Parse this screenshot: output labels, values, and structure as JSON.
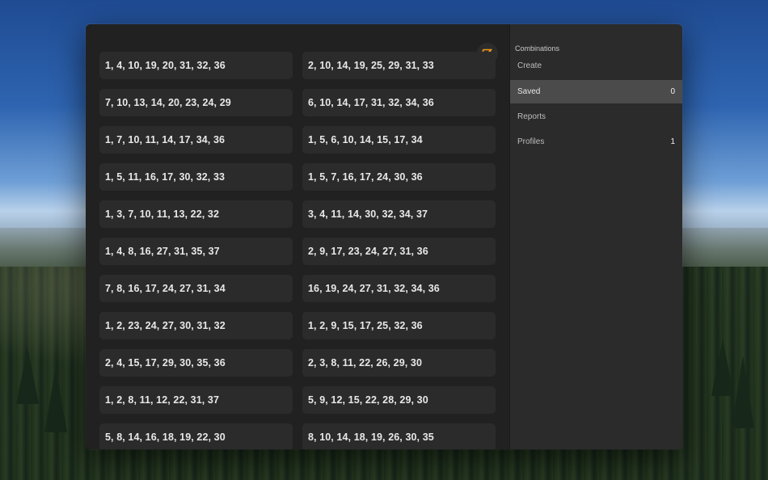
{
  "combinations": [
    "1, 4, 10, 19, 20, 31, 32, 36",
    "2, 10, 14, 19, 25, 29, 31, 33",
    "7, 10, 13, 14, 20, 23, 24, 29",
    "6, 10, 14, 17, 31, 32, 34, 36",
    "1, 7, 10, 11, 14, 17, 34, 36",
    "1, 5, 6, 10, 14, 15, 17, 34",
    "1, 5, 11, 16, 17, 30, 32, 33",
    "1, 5, 7, 16, 17, 24, 30, 36",
    "1, 3, 7, 10, 11, 13, 22, 32",
    "3, 4, 11, 14, 30, 32, 34, 37",
    "1, 4, 8, 16, 27, 31, 35, 37",
    "2, 9, 17, 23, 24, 27, 31, 36",
    "7, 8, 16, 17, 24, 27, 31, 34",
    "16, 19, 24, 27, 31, 32, 34, 36",
    "1, 2, 23, 24, 27, 30, 31, 32",
    "1, 2, 9, 15, 17, 25, 32, 36",
    "2, 4, 15, 17, 29, 30, 35, 36",
    "2, 3, 8, 11, 22, 26, 29, 30",
    "1, 2, 8, 11, 12, 22, 31, 37",
    "5, 9, 12, 15, 22, 28, 29, 30",
    "5, 8, 14, 16, 18, 19, 22, 30",
    "8, 10, 14, 18, 19, 26, 30, 35"
  ],
  "toolbar": {
    "compose_icon": "compose-icon",
    "accent_color": "#f39a1e"
  },
  "sidebar": {
    "header": "Combinations",
    "items": [
      {
        "label": "Create",
        "count": ""
      },
      {
        "label": "Saved",
        "count": "0"
      },
      {
        "label": "Reports",
        "count": ""
      },
      {
        "label": "Profiles",
        "count": "1"
      }
    ],
    "active_item": "Saved"
  }
}
